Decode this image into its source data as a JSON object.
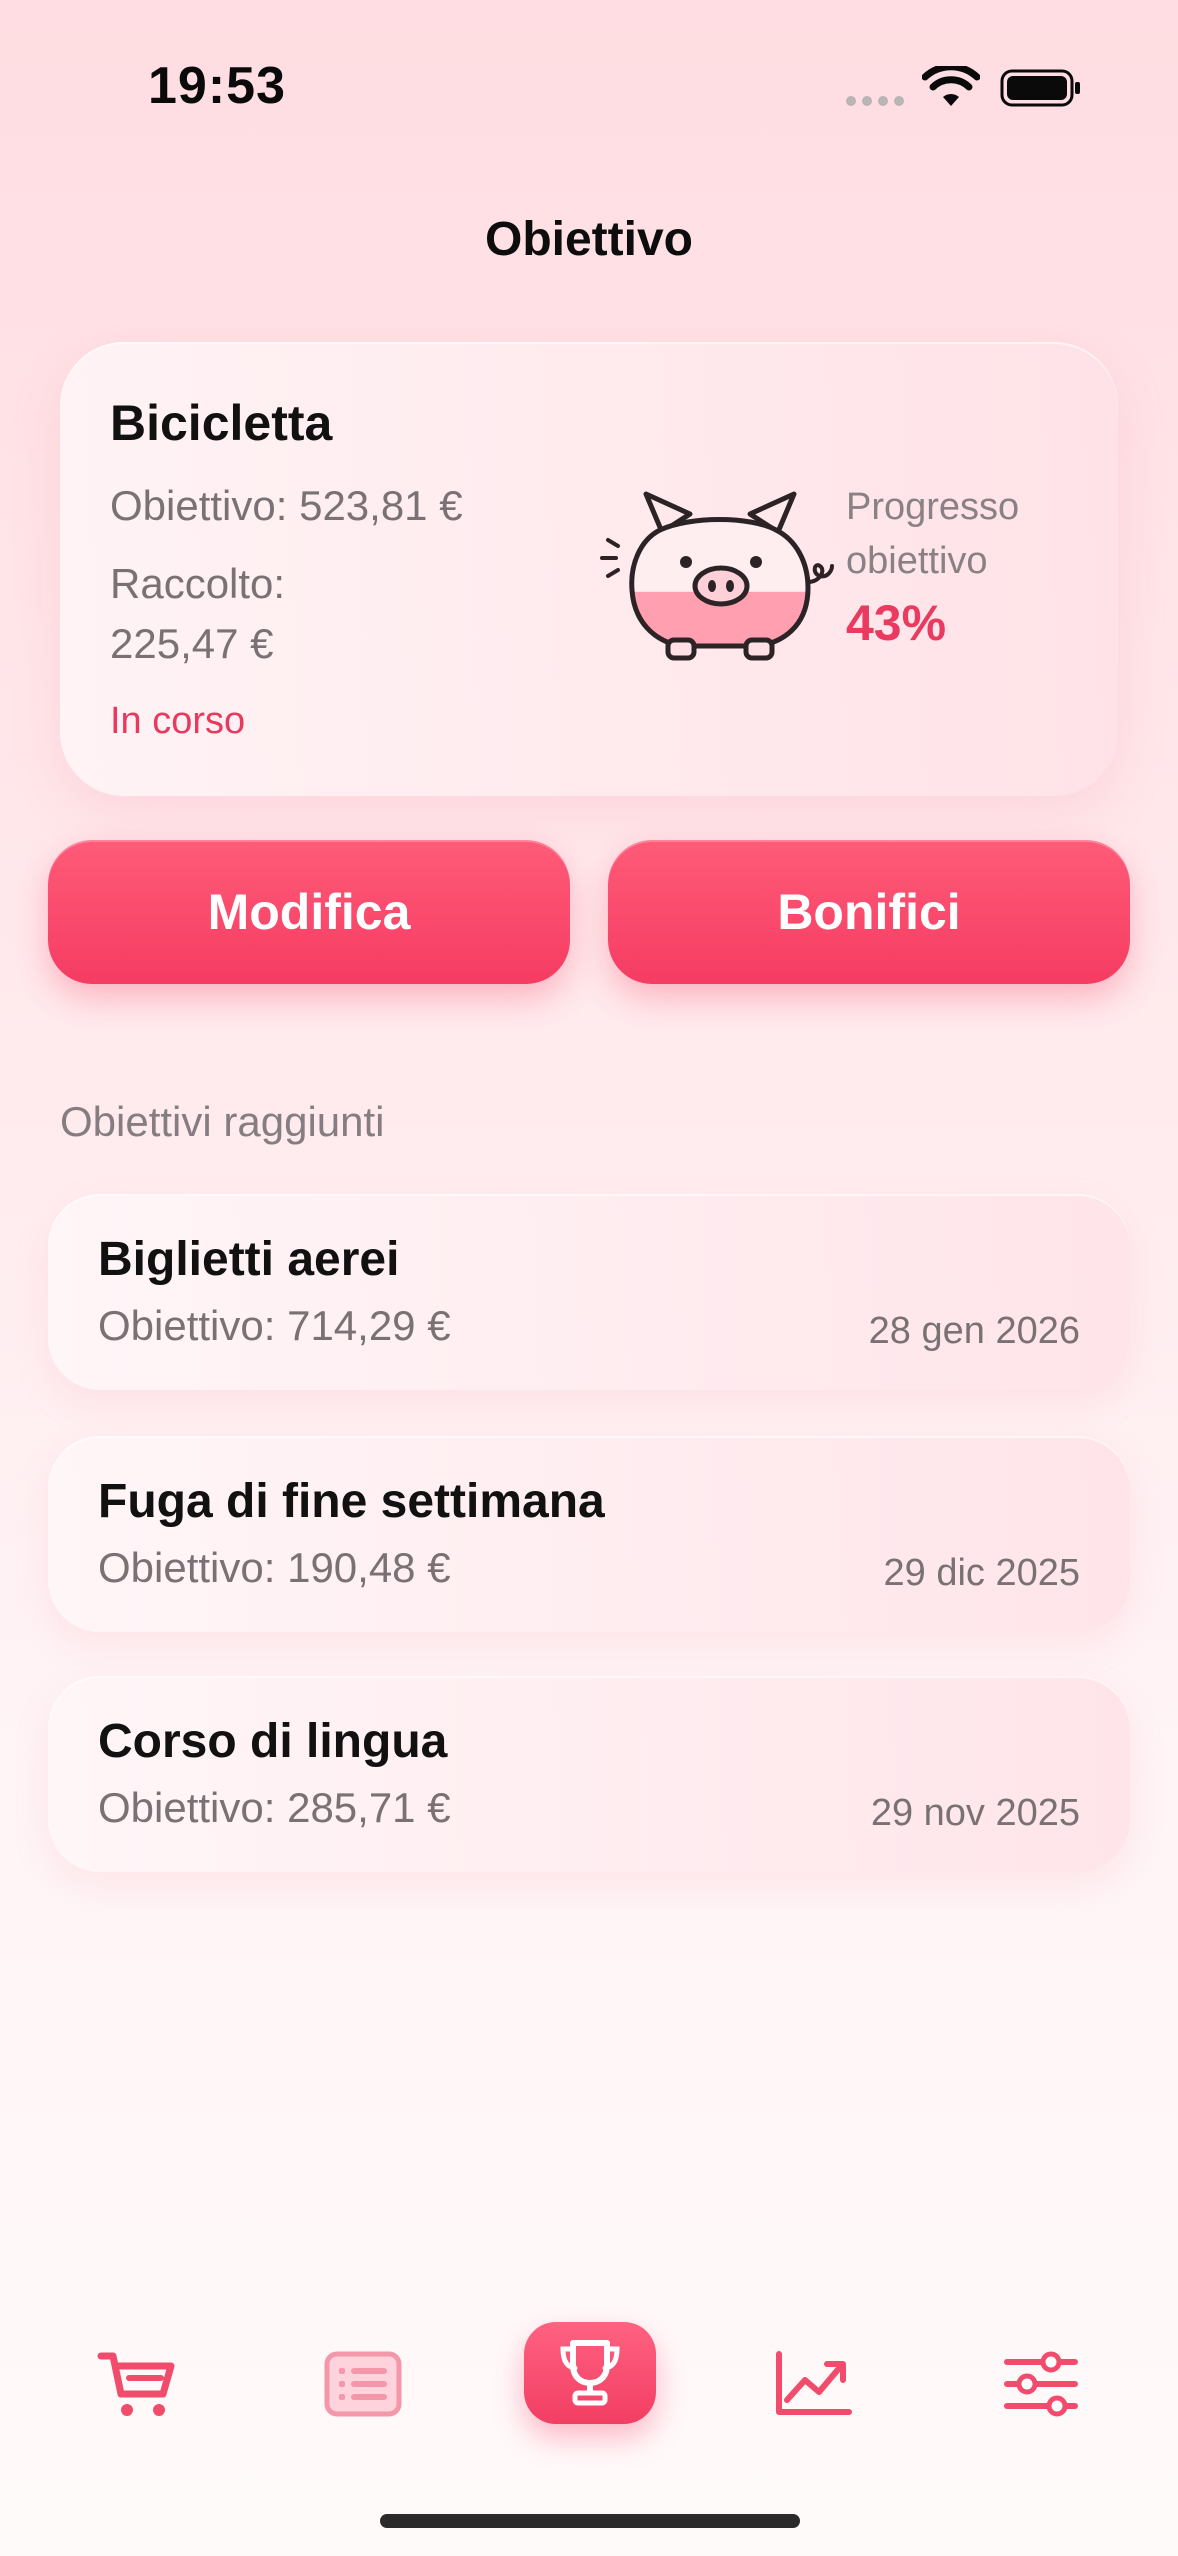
{
  "status_bar": {
    "time": "19:53"
  },
  "page": {
    "title": "Obiettivo"
  },
  "current_goal": {
    "name": "Bicicletta",
    "target": "Obiettivo: 523,81 €",
    "collected_label": "Raccolto:",
    "collected_value": "225,47 €",
    "status": "In corso",
    "progress_label_line1": "Progresso",
    "progress_label_line2": "obiettivo",
    "progress_value": "43%",
    "progress_fraction": 0.43
  },
  "actions": {
    "edit_label": "Modifica",
    "transfers_label": "Bonifici"
  },
  "achieved": {
    "section_title": "Obiettivi raggiunti",
    "items": [
      {
        "name": "Biglietti aerei",
        "target": "Obiettivo: 714,29 €",
        "date": "28 gen 2026"
      },
      {
        "name": "Fuga di fine settimana",
        "target": "Obiettivo: 190,48 €",
        "date": "29 dic 2025"
      },
      {
        "name": "Corso di lingua",
        "target": "Obiettivo: 285,71 €",
        "date": "29 nov 2025"
      }
    ]
  },
  "tab_bar": {
    "items": [
      {
        "icon": "cart-icon",
        "active": false
      },
      {
        "icon": "list-icon",
        "active": false
      },
      {
        "icon": "trophy-icon",
        "active": true
      },
      {
        "icon": "chart-icon",
        "active": false
      },
      {
        "icon": "sliders-icon",
        "active": false
      }
    ]
  },
  "colors": {
    "accent": "#f53c62",
    "accent_light": "#ff5b79",
    "muted_text": "#7a7174",
    "background": "#ffe8eb"
  }
}
